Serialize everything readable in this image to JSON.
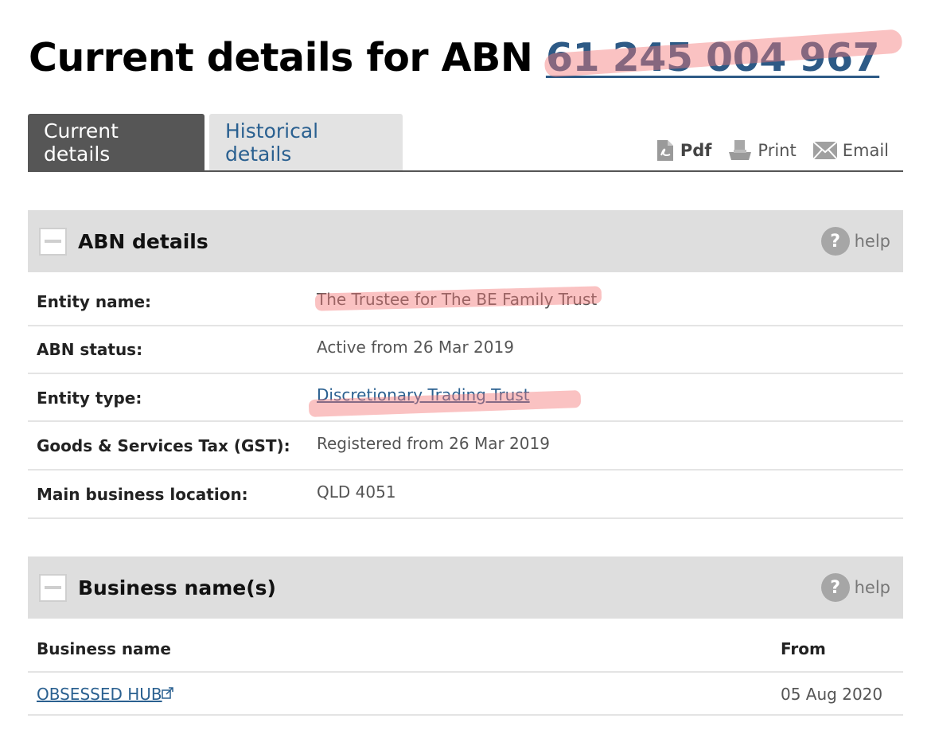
{
  "title": {
    "prefix": "Current details for ABN ",
    "abn": "61 245 004 967"
  },
  "tabs": {
    "current": "Current details",
    "historical": "Historical details"
  },
  "actions": {
    "pdf": "Pdf",
    "print": "Print",
    "email": "Email"
  },
  "abn_details": {
    "heading": "ABN details",
    "help": "help",
    "help_glyph": "?",
    "rows": [
      {
        "label": "Entity name:",
        "value": "The Trustee for The BE Family Trust"
      },
      {
        "label": "ABN status:",
        "value": "Active from 26 Mar 2019"
      },
      {
        "label": "Entity type:",
        "value": "Discretionary Trading Trust"
      },
      {
        "label": "Goods & Services Tax (GST):",
        "value": "Registered from 26 Mar 2019"
      },
      {
        "label": "Main business location:",
        "value": "QLD 4051"
      }
    ]
  },
  "business_names": {
    "heading": "Business name(s)",
    "help": "help",
    "help_glyph": "?",
    "columns": {
      "name": "Business name",
      "from": "From"
    },
    "rows": [
      {
        "name": "OBSESSED HUB",
        "from": "05 Aug 2020"
      }
    ]
  },
  "colors": {
    "link": "#2a6090",
    "active_tab": "#565656",
    "inactive_tab": "#e3e3e3",
    "section_header": "#dedede",
    "highlight": "#f57878"
  },
  "icons": [
    "pdf-icon",
    "print-icon",
    "email-icon",
    "collapse-icon",
    "help-icon",
    "external-link-icon"
  ]
}
